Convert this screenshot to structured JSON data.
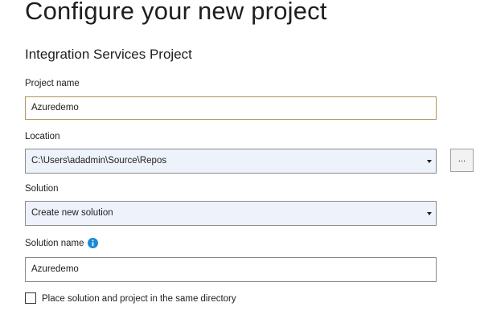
{
  "header": {
    "title": "Configure your new project",
    "project_type": "Integration Services Project"
  },
  "form": {
    "project_name": {
      "label": "Project name",
      "value": "Azuredemo"
    },
    "location": {
      "label": "Location",
      "value": "C:\\Users\\adadmin\\Source\\Repos",
      "browse_label": "..."
    },
    "solution": {
      "label": "Solution",
      "value": "Create new solution"
    },
    "solution_name": {
      "label": "Solution name",
      "value": "Azuredemo",
      "info_icon": "info-icon"
    },
    "same_directory": {
      "label": "Place solution and project in the same directory",
      "checked": false
    }
  },
  "colors": {
    "accent_focus_border": "#b58f5a",
    "combo_background": "#eef2fb",
    "info_icon": "#1b8ad6"
  }
}
